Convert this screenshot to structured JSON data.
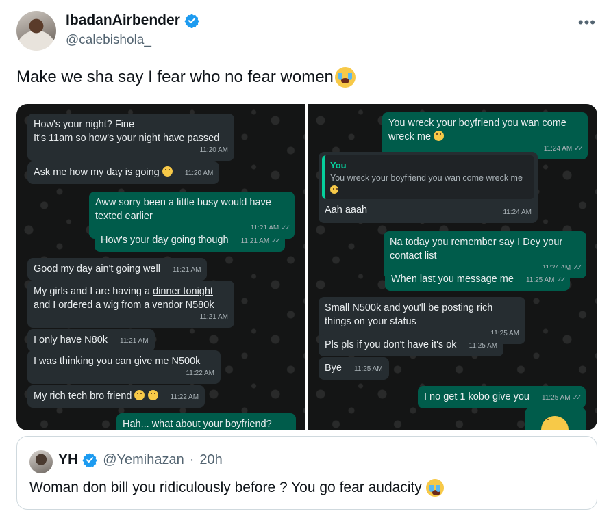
{
  "tweet": {
    "display_name": "IbadanAirbender",
    "handle": "@calebishola_",
    "text": "Make we sha say I fear who no fear women",
    "text_emoji": "loudly-crying-face-emoji",
    "more_icon": "more-horizontal-icon",
    "verified_color": "#1d9bf0"
  },
  "chat_left": {
    "messages": [
      {
        "dir": "in",
        "text": "How's your night? Fine\nIt's 11am so how's your night have passed",
        "time": "11:20 AM"
      },
      {
        "dir": "in",
        "text": "Ask me how my day is going",
        "time": "11:20 AM",
        "emoji": "pleading-face-emoji"
      },
      {
        "dir": "out",
        "text": "Aww sorry been a little busy would have\ntexted earlier",
        "time": "11:21 AM"
      },
      {
        "dir": "out",
        "text": "How's your day going though",
        "time": "11:21 AM"
      },
      {
        "dir": "in",
        "text": "Good my day ain't going well",
        "time": "11:21 AM"
      },
      {
        "dir": "in",
        "text_before": "My girls and I are having a ",
        "text_underlined": "dinner tonight",
        "text_after": "\nand I ordered a wig from a vendor N580k",
        "time": "11:21 AM"
      },
      {
        "dir": "in",
        "text": "I only have N80k",
        "time": "11:21 AM"
      },
      {
        "dir": "in",
        "text": "I was thinking you can give me N500k",
        "time": "11:22 AM"
      },
      {
        "dir": "in",
        "text": "My rich tech bro friend",
        "time": "11:22 AM",
        "emoji": "pleading-face-emoji"
      },
      {
        "dir": "out",
        "text": "Hah... what about your boyfriend?",
        "time": ""
      }
    ]
  },
  "chat_right": {
    "messages": [
      {
        "dir": "out",
        "text": "You wreck your boyfriend you wan come\nwreck me",
        "time": "11:24 AM",
        "emoji": "loudly-crying-face-emoji"
      },
      {
        "dir": "in",
        "reply_to_author": "You",
        "reply_to_text": "You wreck your boyfriend you wan come wreck me",
        "text": "Aah aaah",
        "time": "11:24 AM"
      },
      {
        "dir": "out",
        "text": "Na today you remember say I Dey your\ncontact list",
        "time": "11:24 AM"
      },
      {
        "dir": "out",
        "text": "When last you message me",
        "time": "11:25 AM"
      },
      {
        "dir": "in",
        "text": "Small N500k and you'll be posting rich\nthings on your status",
        "time": "11:25 AM"
      },
      {
        "dir": "in",
        "text": "Pls pls if you don't have it's ok",
        "time": "11:25 AM"
      },
      {
        "dir": "in",
        "text": "Bye",
        "time": "11:25 AM"
      },
      {
        "dir": "out",
        "text": "I no get 1 kobo give you",
        "time": "11:25 AM"
      }
    ]
  },
  "quoted_tweet": {
    "display_name": "YH",
    "handle": "@Yemihazan",
    "separator": "·",
    "age": "20h",
    "text": "Woman don bill you ridiculously before ?  You go fear audacity",
    "text_emoji": "face-with-tears-of-joy-emoji"
  }
}
